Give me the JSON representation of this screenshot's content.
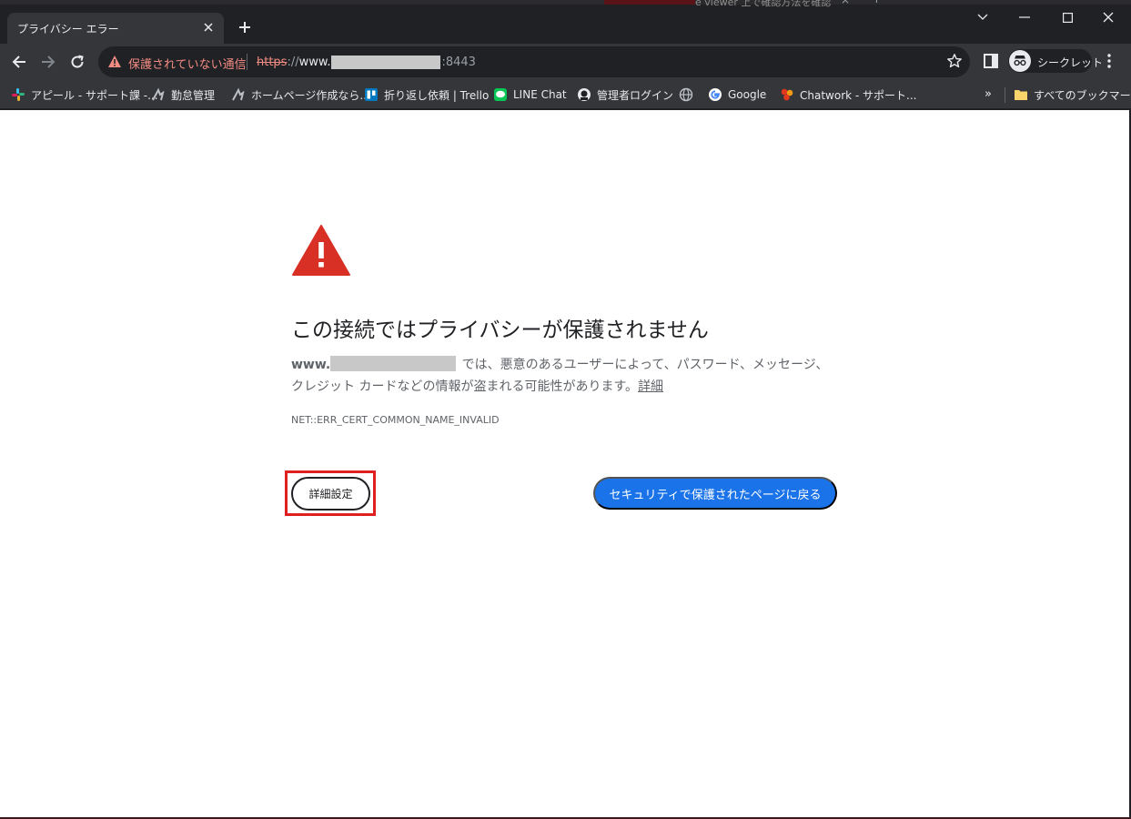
{
  "background_window": {
    "partial_text": "e viewer 上で確認方法を確認"
  },
  "tab": {
    "title": "プライバシー エラー"
  },
  "toolbar": {
    "security_label": "保護されていない通信",
    "url_scheme": "https",
    "url_separator": "://",
    "url_host_prefix": "www.",
    "url_port": ":8443",
    "profile_label": "シークレット"
  },
  "bookmarks": {
    "items": [
      {
        "label": "アピール - サポート課 -...",
        "icon": "slack-icon"
      },
      {
        "label": "勤怠管理",
        "icon": "attendance-icon"
      },
      {
        "label": "ホームページ作成なら...",
        "icon": "homepage-icon"
      },
      {
        "label": "折り返し依頼 | Trello",
        "icon": "trello-icon"
      },
      {
        "label": "LINE Chat",
        "icon": "line-icon"
      },
      {
        "label": "管理者ログイン",
        "icon": "admin-icon"
      },
      {
        "label": "",
        "icon": "globe-icon"
      },
      {
        "label": "Google",
        "icon": "google-icon"
      },
      {
        "label": "Chatwork - サポート...",
        "icon": "chatwork-icon"
      }
    ],
    "more_label": "»",
    "all_bookmarks_label": "すべてのブックマーク"
  },
  "error": {
    "heading": "この接続ではプライバシーが保護されません",
    "host_prefix": "www.",
    "description": " では、悪意のあるユーザーによって、パスワード、メッセージ、クレジット カードなどの情報が盗まれる可能性があります。",
    "learn_more": "詳細",
    "code": "NET::ERR_CERT_COMMON_NAME_INVALID",
    "advanced_button": "詳細設定",
    "back_button": "セキュリティで保護されたページに戻る"
  },
  "colors": {
    "warning_red": "#d93025",
    "primary_blue": "#1a73e8",
    "annotation_red": "#e02020"
  }
}
